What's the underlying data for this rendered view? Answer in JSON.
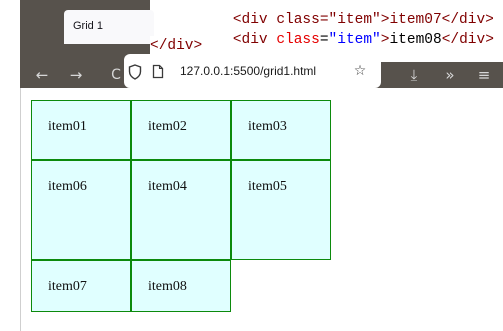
{
  "editor": {
    "line_top_partial": "<div class=\"item\">item07</div>",
    "line_item08": {
      "open": "<div",
      "attr": " class",
      "eq": "=",
      "value": "\"item\"",
      "close": ">",
      "text": "item08",
      "end": "</div>"
    },
    "line_close": "</div>"
  },
  "browser": {
    "tab_title": "Grid 1",
    "url": "127.0.0.1:5500/grid1.html"
  },
  "icons": {
    "back": "←",
    "forward": "→",
    "reload": "C",
    "shield": "shield-icon",
    "page": "page-icon",
    "star": "☆",
    "download": "⤓",
    "overflow": "»",
    "menu": "≡"
  },
  "grid": {
    "items": [
      "item01",
      "item02",
      "item03",
      "item04",
      "item05",
      "item06",
      "item07",
      "item08"
    ],
    "colors": {
      "background": "#e0ffff",
      "border": "#0c8a0c"
    }
  }
}
